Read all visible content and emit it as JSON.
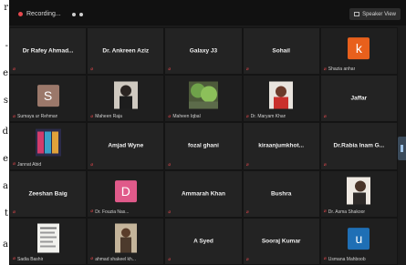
{
  "left_strip": {
    "letters": [
      "r",
      "-",
      "e",
      "s",
      "d",
      "e",
      "a",
      "t",
      "a"
    ]
  },
  "topbar": {
    "recording_label": "Recording...",
    "view_label": "Speaker View"
  },
  "participants": [
    {
      "name": "Dr Rafey Ahmad...",
      "kind": "name",
      "label": ""
    },
    {
      "name": "Dr. Ankreen Aziz",
      "kind": "name",
      "label": ""
    },
    {
      "name": "Galaxy J3",
      "kind": "name",
      "label": ""
    },
    {
      "name": "Sohail",
      "kind": "name",
      "label": ""
    },
    {
      "name": "",
      "kind": "avatar",
      "letter": "k",
      "avatar_color": "#e8601c",
      "label": "Shazia anhar"
    },
    {
      "name": "",
      "kind": "avatar",
      "letter": "S",
      "avatar_color": "#9b786a",
      "label": "Sumaya ur Rehman"
    },
    {
      "name": "",
      "kind": "video",
      "video": "woman",
      "label": "Maheen Raja"
    },
    {
      "name": "",
      "kind": "video",
      "video": "plant",
      "label": "Maheen Iqbal"
    },
    {
      "name": "",
      "kind": "video",
      "video": "woman-red",
      "label": "Dr. Maryam Khan"
    },
    {
      "name": "Jaffar",
      "kind": "name",
      "label": ""
    },
    {
      "name": "",
      "kind": "video",
      "video": "colorful",
      "label": "Jannat Abid"
    },
    {
      "name": "Amjad Wyne",
      "kind": "name",
      "label": ""
    },
    {
      "name": "fozal ghani",
      "kind": "name",
      "label": ""
    },
    {
      "name": "kiraanjumkhot...",
      "kind": "name",
      "label": ""
    },
    {
      "name": "Dr.Rabia Inam G...",
      "kind": "name",
      "label": ""
    },
    {
      "name": "Zeeshan Baig",
      "kind": "name",
      "label": ""
    },
    {
      "name": "",
      "kind": "avatar",
      "letter": "D",
      "avatar_color": "#e05a8a",
      "label": "Dr. Fouzia Nas..."
    },
    {
      "name": "Ammarah Khan",
      "kind": "name",
      "label": ""
    },
    {
      "name": "Bushra",
      "kind": "name",
      "label": ""
    },
    {
      "name": "",
      "kind": "video",
      "video": "man-wall",
      "label": "Dr. Asma Shakoor"
    },
    {
      "name": "",
      "kind": "video",
      "video": "document",
      "label": "Sadia Bashir"
    },
    {
      "name": "",
      "kind": "video",
      "video": "man-room",
      "label": "ahmad shakeel kh..."
    },
    {
      "name": "A Syed",
      "kind": "name",
      "label": ""
    },
    {
      "name": "Sooraj Kumar",
      "kind": "name",
      "label": ""
    },
    {
      "name": "",
      "kind": "avatar",
      "letter": "u",
      "avatar_color": "#1f6fb5",
      "label": "Usmana Mahboob"
    }
  ]
}
